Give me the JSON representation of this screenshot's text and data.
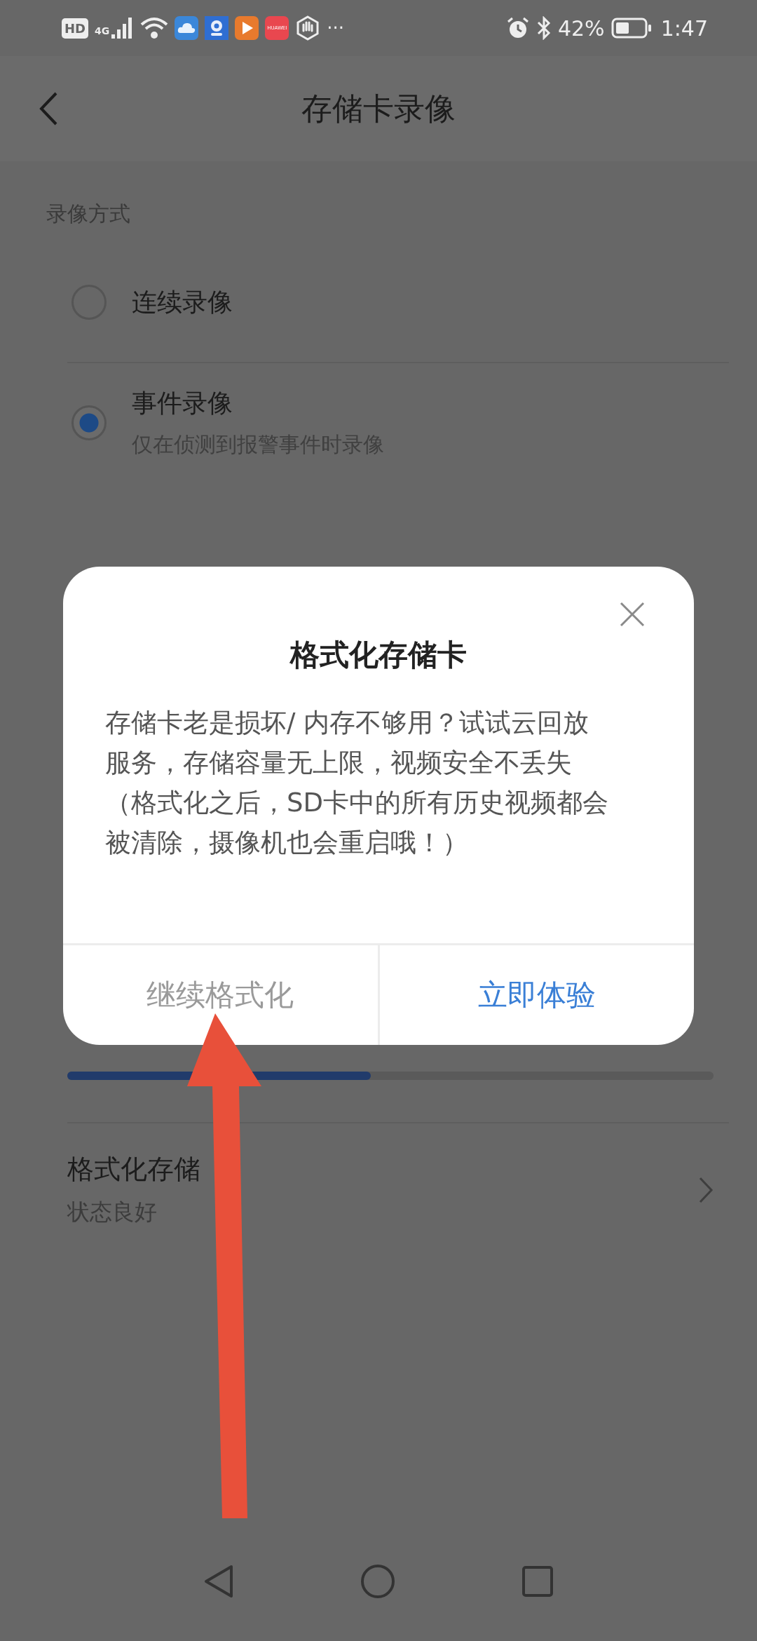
{
  "status_bar": {
    "hd": "HD",
    "network": "4G",
    "app_label": "HUAWEI",
    "more": "···",
    "battery": "42%",
    "time": "1:47"
  },
  "header": {
    "title": "存储卡录像"
  },
  "recording_mode": {
    "label": "录像方式",
    "options": [
      {
        "title": "连续录像",
        "selected": false
      },
      {
        "title": "事件录像",
        "subtitle": "仅在侦测到报警事件时录像",
        "selected": true
      }
    ]
  },
  "storage": {
    "level": 0.47
  },
  "format_row": {
    "title": "格式化存储",
    "subtitle": "状态良好"
  },
  "dialog": {
    "title": "格式化存储卡",
    "message": [
      "存储卡老是损坏/ 内存不够用？试试云回放服务，存储容量无上限，视频安全不丢失",
      "（格式化之后，SD卡中的所有历史视频都会被清除，摄像机也会重启哦！）"
    ],
    "buttons": [
      {
        "label": "继续格式化",
        "kind": "secondary"
      },
      {
        "label": "立即体验",
        "kind": "primary"
      }
    ]
  }
}
